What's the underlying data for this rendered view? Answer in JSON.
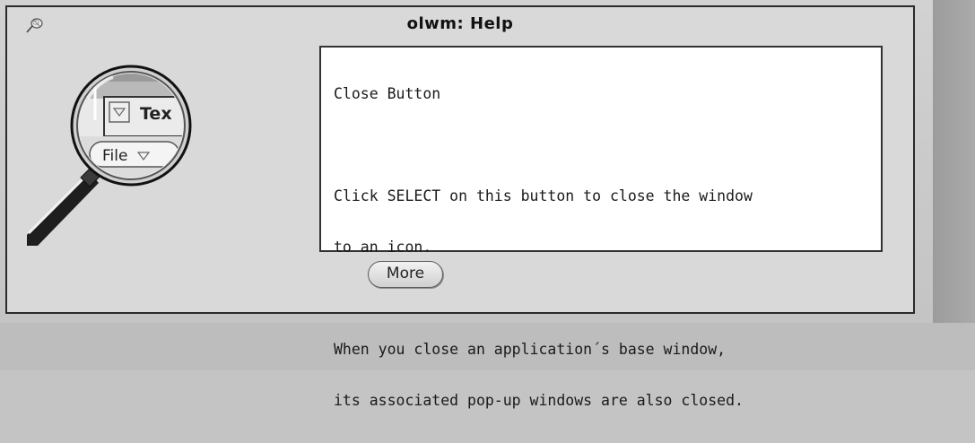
{
  "window": {
    "title": "olwm: Help"
  },
  "illustration": {
    "magnified_control_label": "Tex",
    "magnified_menu_label": "File"
  },
  "help_text": {
    "heading": "Close Button",
    "lines": [
      "Click SELECT on this button to close the window",
      "to an icon.",
      "When you close an application´s base window,",
      "its associated pop-up windows are also closed."
    ]
  },
  "buttons": {
    "more_label": "More"
  }
}
